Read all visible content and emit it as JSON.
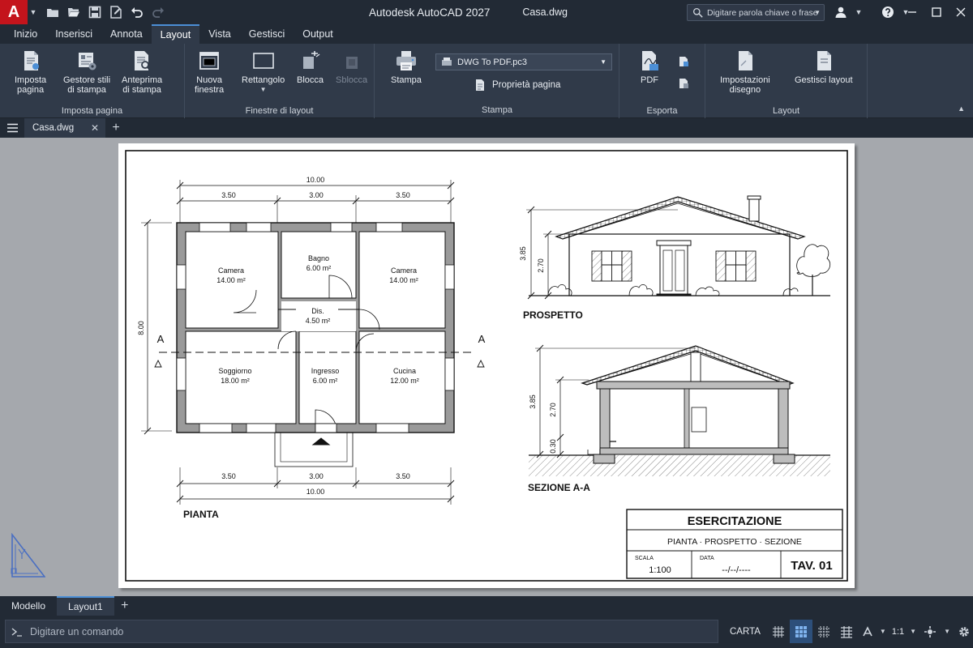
{
  "app": {
    "title": "Autodesk AutoCAD 2027",
    "file_name": "Casa.dwg",
    "logo_letter": "A"
  },
  "search": {
    "placeholder": "Digitare parola chiave o frase"
  },
  "ribbon_tabs": [
    "Inizio",
    "Inserisci",
    "Annota",
    "Layout",
    "Vista",
    "Gestisci",
    "Output"
  ],
  "active_ribbon_tab": "Layout",
  "ribbon": {
    "imposta_pagina": {
      "label": "Imposta pagina",
      "btn_imposta": [
        "Imposta",
        "pagina"
      ],
      "btn_gestore": [
        "Gestore stili",
        "di stampa"
      ],
      "btn_anteprima": [
        "Anteprima",
        "di stampa"
      ]
    },
    "finestre": {
      "label": "Finestre di layout",
      "btn_nuova": [
        "Nuova",
        "finestra"
      ],
      "btn_rettangolo": "Rettangolo",
      "btn_blocca": "Blocca",
      "btn_sblocca": "Sblocca"
    },
    "stampa": {
      "label": "Stampa",
      "btn_stampa": "Stampa",
      "printer_select": "DWG To PDF.pc3",
      "btn_proprieta": "Proprietà pagina"
    },
    "esporta": {
      "label": "Esporta",
      "btn_pdf": "PDF"
    },
    "layout": {
      "label": "Layout",
      "btn_impostazioni": [
        "Impostazioni",
        "disegno"
      ],
      "btn_gestisci": "Gestisci layout"
    }
  },
  "doc_tab": {
    "name": "Casa.dwg"
  },
  "drawing": {
    "plan": {
      "title": "PIANTA",
      "dim_total_top": "10.00",
      "dims_top": [
        "3.50",
        "3.00",
        "3.50"
      ],
      "dims_bottom": [
        "3.50",
        "3.00",
        "3.50"
      ],
      "dim_total_bottom": "10.00",
      "dim_left": "8.00",
      "section_letter": "A",
      "rooms": [
        {
          "name": "Camera",
          "area": "14.00 m²"
        },
        {
          "name": "Bagno",
          "area": "6.00 m²"
        },
        {
          "name": "Camera",
          "area": "14.00 m²"
        },
        {
          "name": "Dis.",
          "area": "4.50 m²"
        },
        {
          "name": "Soggiorno",
          "area": "18.00 m²"
        },
        {
          "name": "Ingresso",
          "area": "6.00 m²"
        },
        {
          "name": "Cucina",
          "area": "12.00 m²"
        }
      ]
    },
    "elevation": {
      "title": "PROSPETTO",
      "dim_total": "3.85",
      "dim_wall": "2.70"
    },
    "section": {
      "title": "SEZIONE A-A",
      "dim_total": "3.85",
      "dim_wall": "2.70",
      "dim_base": "0.30"
    },
    "title_block": {
      "heading": "ESERCITAZIONE",
      "subtitle": "PIANTA · PROSPETTO · SEZIONE",
      "scale_label": "SCALA",
      "scale_value": "1:100",
      "date_label": "DATA",
      "date_value": "--/--/----",
      "sheet": "TAV. 01"
    }
  },
  "layout_tabs": [
    "Modello",
    "Layout1"
  ],
  "active_layout_tab": "Layout1",
  "command": {
    "placeholder": "Digitare un comando"
  },
  "status": {
    "space": "CARTA",
    "scale": "1:1"
  },
  "colors": {
    "accent": "#4c8fd6",
    "logo_red": "#c4141c",
    "chrome": "#222a35",
    "ribbon": "#303a49"
  }
}
